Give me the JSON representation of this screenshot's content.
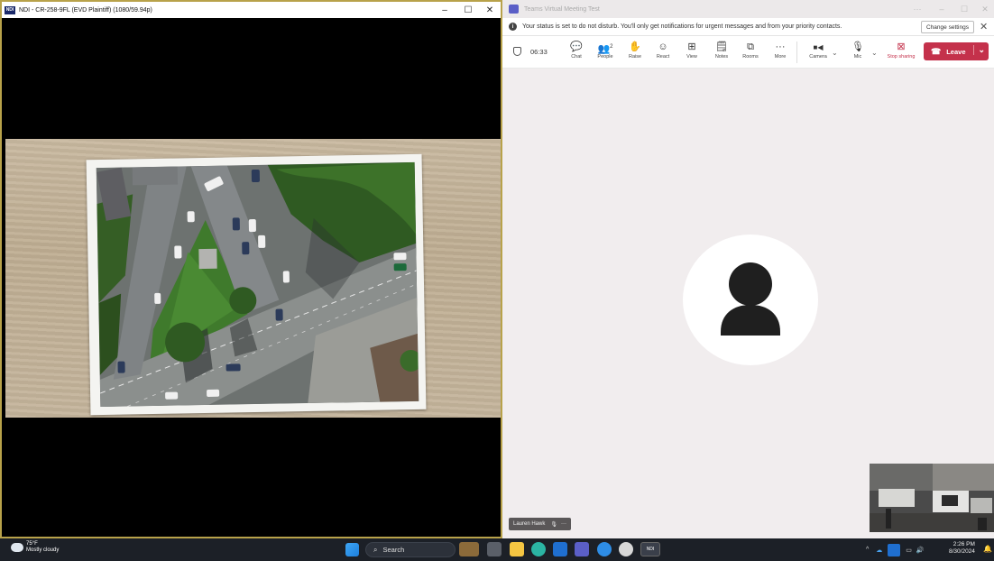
{
  "ndi": {
    "title": "NDI - CR-258-9FL (EVD Plaintiff) (1080/59.94p)",
    "logo_text": "NDI",
    "minimize": "–",
    "maximize": "☐",
    "close": "✕"
  },
  "teams": {
    "title": "Teams Virtual Meeting Test",
    "window_controls": [
      "···",
      "–",
      "☐",
      "✕"
    ],
    "banner": {
      "info_glyph": "i",
      "text": "Your status is set to do not disturb. You'll only get notifications for urgent messages and from your priority contacts.",
      "change_settings": "Change settings",
      "close": "✕"
    },
    "timer": "06:33",
    "toolbar": [
      {
        "label": "Chat",
        "icon": "chat-icon",
        "glyph": "💬"
      },
      {
        "label": "People",
        "icon": "people-icon",
        "glyph": "👥",
        "badge": "2"
      },
      {
        "label": "Raise",
        "icon": "raise-hand-icon",
        "glyph": "✋"
      },
      {
        "label": "React",
        "icon": "react-icon",
        "glyph": "☺"
      },
      {
        "label": "View",
        "icon": "view-icon",
        "glyph": "⊞"
      },
      {
        "label": "Notes",
        "icon": "notes-icon",
        "glyph": "🗒"
      },
      {
        "label": "Rooms",
        "icon": "rooms-icon",
        "glyph": "⧉"
      },
      {
        "label": "More",
        "icon": "more-icon",
        "glyph": "···"
      },
      {
        "label": "Camera",
        "icon": "camera-icon",
        "glyph": "■◀"
      },
      {
        "label": "Mic",
        "icon": "mic-icon",
        "glyph": "🎙"
      },
      {
        "label": "Stop sharing",
        "icon": "stop-sharing-icon",
        "glyph": "⊠"
      }
    ],
    "leave_label": "Leave",
    "participant_name": "Lauren Hawk",
    "participant_more": "···"
  },
  "taskbar": {
    "temperature": "75°F",
    "weather": "Mostly cloudy",
    "search_label": "Search",
    "ndi_label": "NDI",
    "time": "2:26 PM",
    "date": "8/30/2024"
  },
  "colors": {
    "leave": "#c4314b",
    "ndi_border": "#b8a24a",
    "taskbar": "#1c2027",
    "teams_accent": "#5b5fc7"
  }
}
